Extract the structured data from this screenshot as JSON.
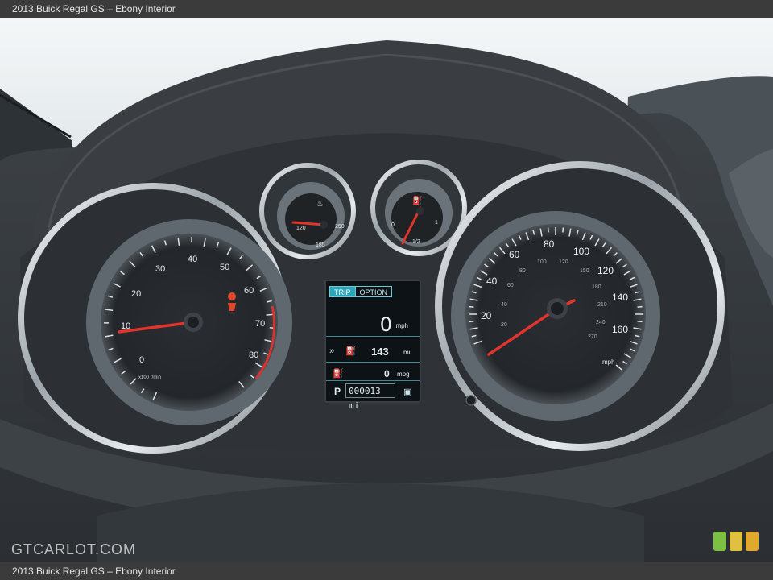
{
  "header": {
    "caption": "2013 Buick Regal GS – Ebony Interior"
  },
  "footer": {
    "caption": "2013 Buick Regal GS – Ebony Interior",
    "watermark": "GTCARLOT.COM"
  },
  "badge_colors": [
    "#7bc043",
    "#e0c040",
    "#e0a830"
  ],
  "tachometer": {
    "labels": [
      "0",
      "10",
      "20",
      "30",
      "40",
      "50",
      "60",
      "70",
      "80"
    ],
    "unit_text": "x100 r/min"
  },
  "speedometer": {
    "mph_labels": [
      "20",
      "40",
      "60",
      "80",
      "100",
      "120",
      "140",
      "160"
    ],
    "kmh_labels": [
      "20",
      "40",
      "60",
      "80",
      "100",
      "120",
      "150",
      "180",
      "210",
      "240",
      "270"
    ],
    "unit": "mph"
  },
  "temp_gauge": {
    "low": "120",
    "mid": "185",
    "high": "250"
  },
  "fuel_gauge": {
    "low": "0",
    "mid": "1/2",
    "high": "1"
  },
  "lcd": {
    "tab_trip": "TRIP",
    "tab_option": "OPTION",
    "speed": "0",
    "speed_unit": "mph",
    "range": "143",
    "range_unit": "mi",
    "mpg": "0",
    "mpg_unit": "mpg",
    "gear": "P",
    "odometer": "000013 mi"
  }
}
